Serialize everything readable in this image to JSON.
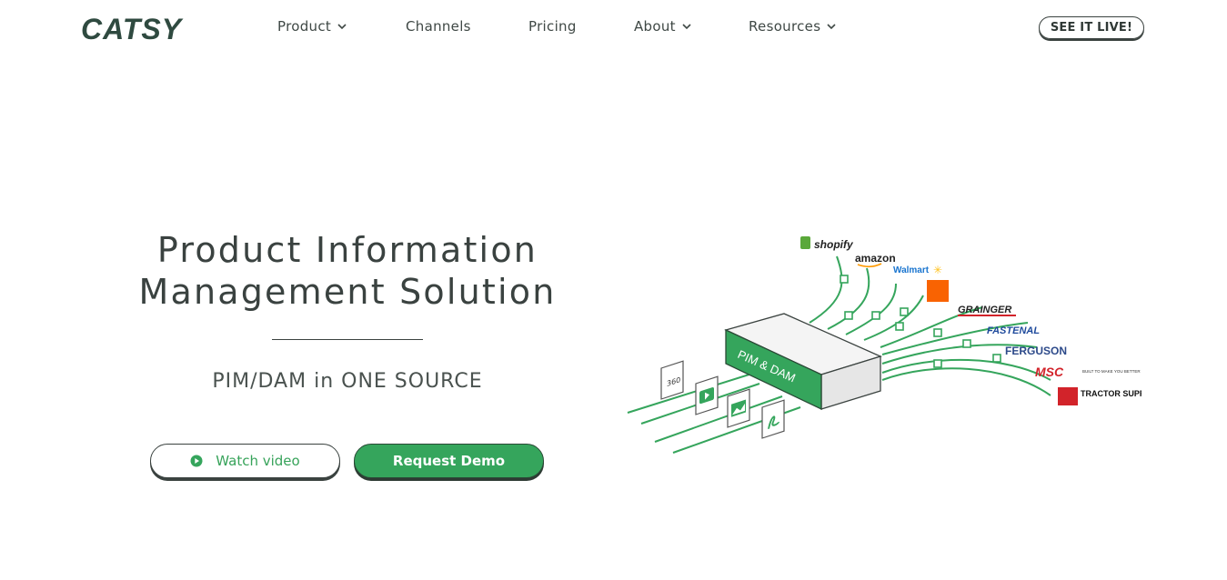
{
  "brand": {
    "name": "CATSY",
    "color": "#2f4a40",
    "accent": "#35a55c"
  },
  "nav": {
    "items": [
      {
        "label": "Product",
        "dropdown": true
      },
      {
        "label": "Channels",
        "dropdown": false
      },
      {
        "label": "Pricing",
        "dropdown": false
      },
      {
        "label": "About",
        "dropdown": true
      },
      {
        "label": "Resources",
        "dropdown": true
      }
    ],
    "cta_label": "SEE IT LIVE!"
  },
  "hero": {
    "title_line1": "Product Information",
    "title_line2": "Management Solution",
    "subtitle": "PIM/DAM in ONE SOURCE",
    "watch_label": "Watch video",
    "demo_label": "Request Demo"
  },
  "illustration": {
    "hub_label": "PIM & DAM",
    "channels": [
      "shopify",
      "amazon",
      "Walmart",
      "GRAINGER",
      "FASTENAL",
      "FERGUSON",
      "MSC",
      "TRACTOR SUPPLY CO"
    ],
    "msc_tagline": "BUILT TO MAKE YOU BETTER",
    "icons": [
      "360-view-icon",
      "video-icon",
      "image-icon",
      "pdf-icon"
    ]
  }
}
